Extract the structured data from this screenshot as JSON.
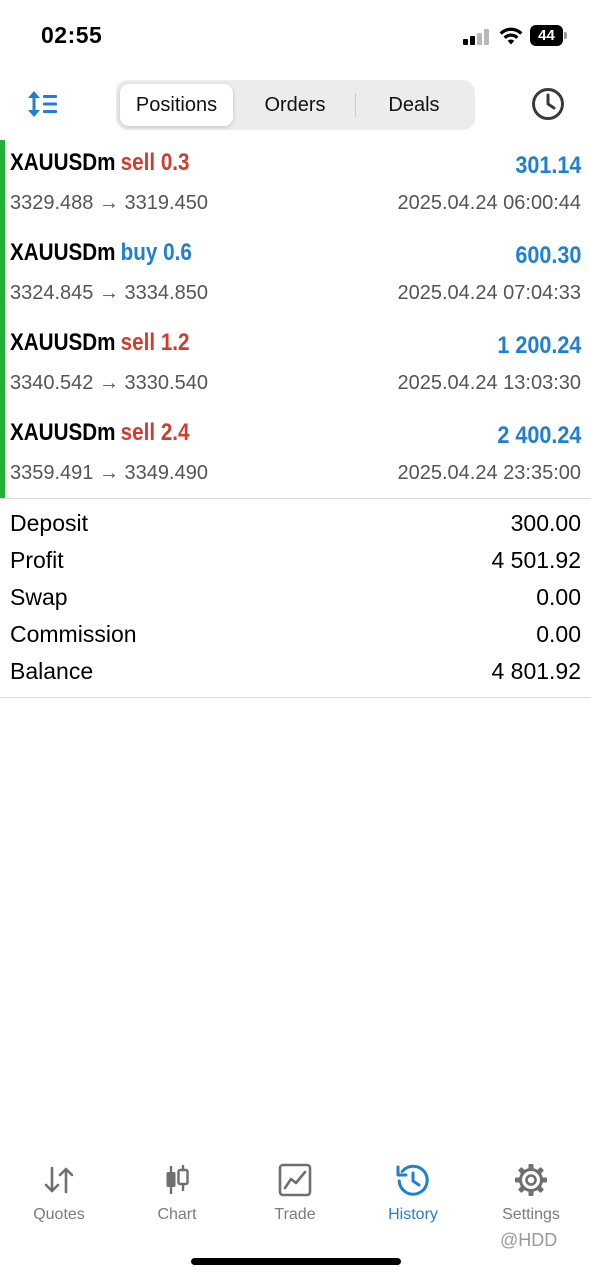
{
  "status_bar": {
    "time": "02:55",
    "battery": "44"
  },
  "toolbar": {
    "tabs": [
      {
        "label": "Positions",
        "active": true
      },
      {
        "label": "Orders",
        "active": false
      },
      {
        "label": "Deals",
        "active": false
      }
    ],
    "sort_icon": "sort-arrows-icon",
    "period_icon": "clock-icon"
  },
  "positions": [
    {
      "symbol": "XAUUSDm",
      "type_lot": "sell 0.3",
      "side": "sell",
      "profit": "301.14",
      "prices": "3329.488 → 3319.450",
      "time": "2025.04.24 06:00:44"
    },
    {
      "symbol": "XAUUSDm",
      "type_lot": "buy 0.6",
      "side": "buy",
      "profit": "600.30",
      "prices": "3324.845 → 3334.850",
      "time": "2025.04.24 07:04:33"
    },
    {
      "symbol": "XAUUSDm",
      "type_lot": "sell 1.2",
      "side": "sell",
      "profit": "1 200.24",
      "prices": "3340.542 → 3330.540",
      "time": "2025.04.24 13:03:30"
    },
    {
      "symbol": "XAUUSDm",
      "type_lot": "sell 2.4",
      "side": "sell",
      "profit": "2 400.24",
      "prices": "3359.491 → 3349.490",
      "time": "2025.04.24 23:35:00"
    }
  ],
  "summary": [
    {
      "label": "Deposit",
      "value": "300.00"
    },
    {
      "label": "Profit",
      "value": "4 501.92"
    },
    {
      "label": "Swap",
      "value": "0.00"
    },
    {
      "label": "Commission",
      "value": "0.00"
    },
    {
      "label": "Balance",
      "value": "4 801.92"
    }
  ],
  "tab_bar": [
    {
      "label": "Quotes",
      "icon": "quotes-arrows-icon",
      "active": false
    },
    {
      "label": "Chart",
      "icon": "candlestick-icon",
      "active": false
    },
    {
      "label": "Trade",
      "icon": "trade-chart-icon",
      "active": false
    },
    {
      "label": "History",
      "icon": "history-clock-icon",
      "active": true
    },
    {
      "label": "Settings",
      "icon": "gear-icon",
      "active": false
    }
  ],
  "watermark": "@HDD",
  "colors": {
    "sell": "#d13c2f",
    "buy": "#1f7fd4",
    "profit": "#1f7fd4",
    "accent": "#1f7fd4",
    "position_bar": "#22b036"
  }
}
